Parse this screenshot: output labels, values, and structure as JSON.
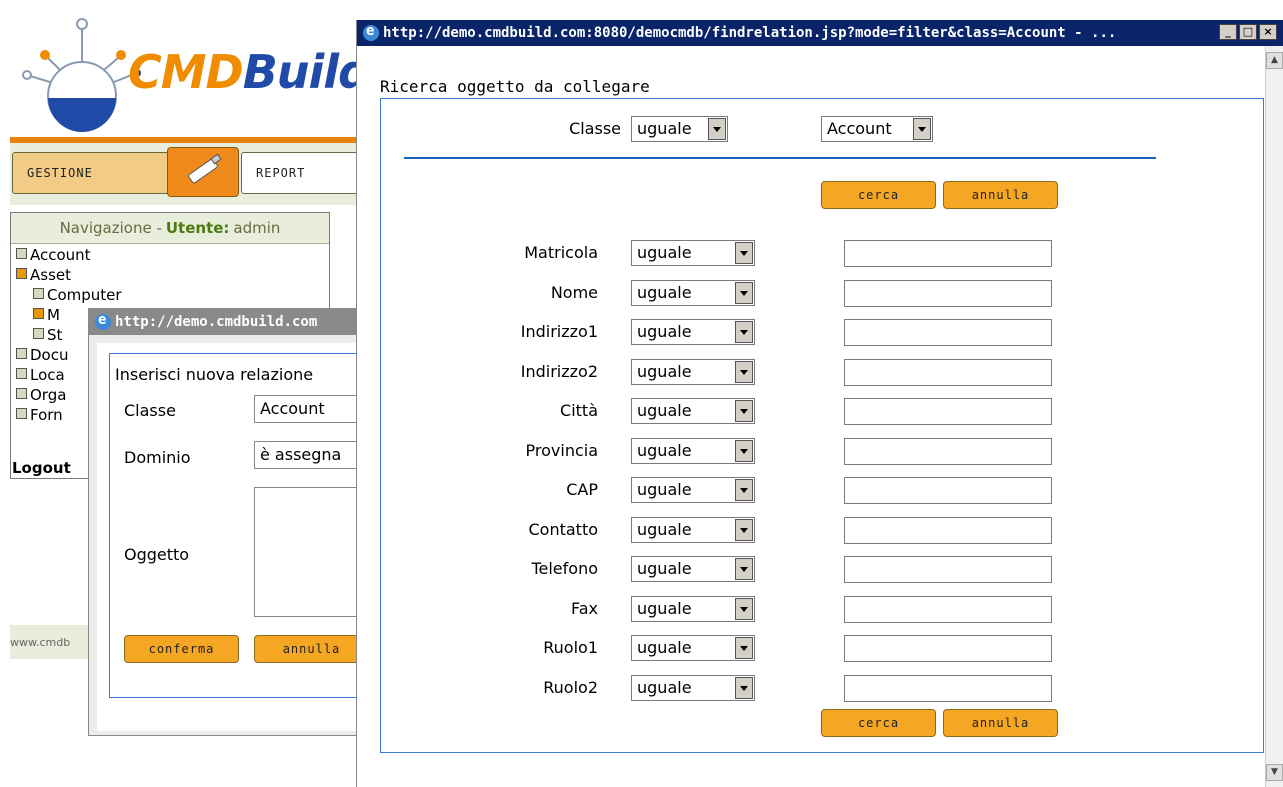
{
  "main_app": {
    "logo_text_orange": "CMD",
    "logo_text_blue": "Build",
    "tabs": {
      "gestione": "GESTIONE",
      "report": "REPORT"
    },
    "nav": {
      "header_prefix": "Navigazione -",
      "header_user_label": "Utente:",
      "header_user": "admin",
      "items": [
        "Account",
        "Asset",
        "Computer",
        "M",
        "St",
        "Docu",
        "Loca",
        "Orga",
        "Forn"
      ]
    },
    "logout": "Logout",
    "footer": "www.cmdb"
  },
  "window_relazione": {
    "title": "http://demo.cmdbuild.com",
    "legend": "Inserisci nuova relazione",
    "classe_label": "Classe",
    "classe_value": "Account",
    "dominio_label": "Dominio",
    "dominio_value": "è assegna",
    "oggetto_label": "Oggetto",
    "confirm_label": "conferma",
    "cancel_label": "annulla"
  },
  "window_find": {
    "title": "http://demo.cmdbuild.com:8080/democmdb/findrelation.jsp?mode=filter&class=Account - ...",
    "controls": {
      "minimize": "_",
      "maximize": "□",
      "close": "×"
    },
    "legend": "Ricerca oggetto da collegare",
    "classe_label": "Classe",
    "classe_operator": "uguale",
    "classe_value": "Account",
    "search_label": "cerca",
    "cancel_label": "annulla",
    "fields": [
      {
        "label": "Matricola",
        "operator": "uguale",
        "value": ""
      },
      {
        "label": "Nome",
        "operator": "uguale",
        "value": ""
      },
      {
        "label": "Indirizzo1",
        "operator": "uguale",
        "value": ""
      },
      {
        "label": "Indirizzo2",
        "operator": "uguale",
        "value": ""
      },
      {
        "label": "Città",
        "operator": "uguale",
        "value": ""
      },
      {
        "label": "Provincia",
        "operator": "uguale",
        "value": ""
      },
      {
        "label": "CAP",
        "operator": "uguale",
        "value": ""
      },
      {
        "label": "Contatto",
        "operator": "uguale",
        "value": ""
      },
      {
        "label": "Telefono",
        "operator": "uguale",
        "value": ""
      },
      {
        "label": "Fax",
        "operator": "uguale",
        "value": ""
      },
      {
        "label": "Ruolo1",
        "operator": "uguale",
        "value": ""
      },
      {
        "label": "Ruolo2",
        "operator": "uguale",
        "value": ""
      }
    ]
  },
  "colors": {
    "accent_orange": "#f5a623",
    "panel_border_blue": "#3a7ad0",
    "active_title": "#0a246a",
    "inactive_title": "#8a8a8a",
    "brand_green_bg": "#e8eedb"
  }
}
